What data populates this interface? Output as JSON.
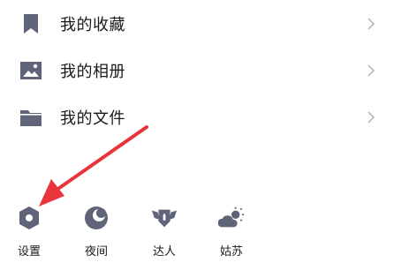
{
  "menu": {
    "items": [
      {
        "label": "我的收藏",
        "icon": "bookmark-icon"
      },
      {
        "label": "我的相册",
        "icon": "image-icon"
      },
      {
        "label": "我的文件",
        "icon": "folder-icon"
      }
    ]
  },
  "bottom": {
    "items": [
      {
        "label": "设置",
        "icon": "settings-hexagon-icon"
      },
      {
        "label": "夜间",
        "icon": "moon-icon"
      },
      {
        "label": "达人",
        "icon": "winged-badge-icon"
      },
      {
        "label": "姑苏",
        "icon": "weather-cloud-sun-icon"
      }
    ]
  },
  "colors": {
    "icon": "#5f6478",
    "text": "#1a1a1a",
    "chevron": "#b8b8bc",
    "annotation_arrow": "#e8343a"
  }
}
